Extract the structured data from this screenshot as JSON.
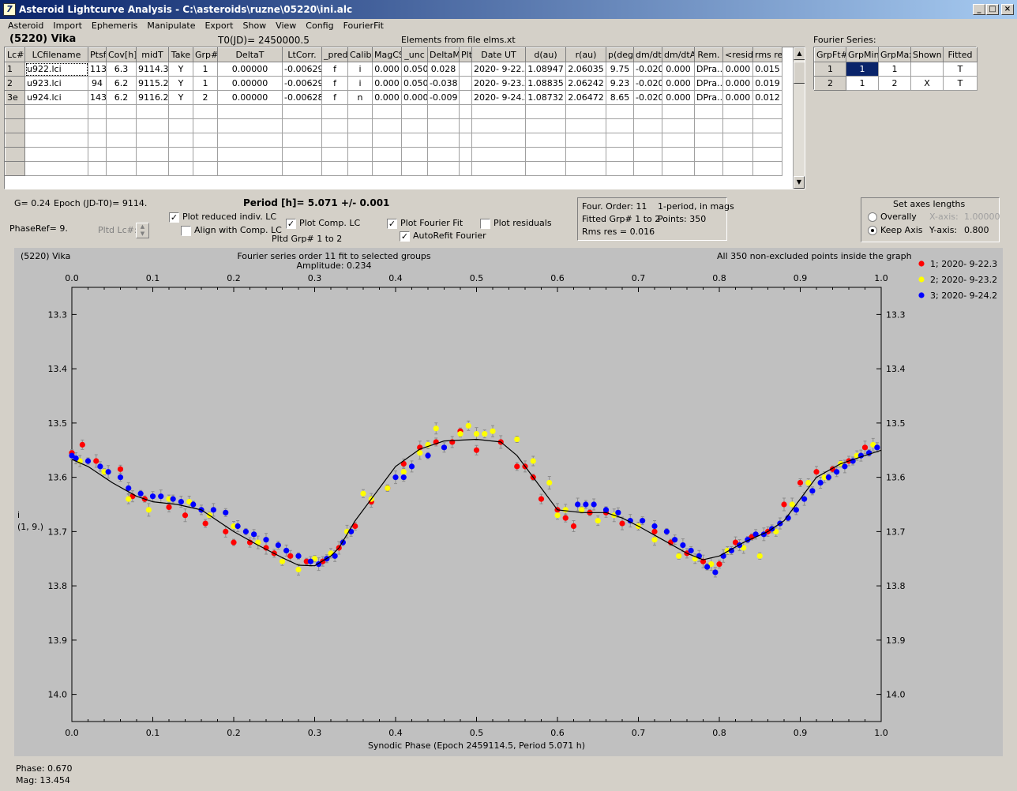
{
  "window": {
    "title": "Asteroid Lightcurve Analysis - C:\\asteroids\\ruzne\\05220\\ini.alc",
    "icon": "app-logo-icon",
    "controls": [
      "_",
      "□",
      "×"
    ]
  },
  "menu": [
    "Asteroid",
    "Import",
    "Ephemeris",
    "Manipulate",
    "Export",
    "Show",
    "View",
    "Config",
    "FourierFit"
  ],
  "header": {
    "asteroid": "(5220) Vika",
    "t0": "T0(JD)= 2450000.5",
    "elements": "Elements from file elms.xt",
    "fourier_label": "Fourier Series:"
  },
  "lc_table": {
    "columns": [
      "Lc#",
      "LCfilename",
      "Ptsf",
      "Cov[h]",
      "midT",
      "Take",
      "Grp#",
      "DeltaT",
      "LtCorr.",
      "_pred.",
      "Calib",
      "MagCS",
      "_unc",
      "DeltaM",
      "Plt",
      "Date UT",
      "d(au)",
      "r(au)",
      "p(deg)",
      "dm/dt",
      "dm/dtA",
      "Rem.",
      "<resid>",
      "rms res"
    ],
    "rows": [
      [
        "1",
        "u922.lci",
        "113",
        "6.3",
        "9114.3",
        "Y",
        "1",
        "0.00000",
        "-0.00629",
        "f",
        "i",
        "0.000",
        "0.050",
        "0.028",
        "",
        "2020- 9-22.3",
        "1.08947",
        "2.06035",
        "9.75",
        "-0.020",
        "0.000",
        "DPra...",
        "0.000",
        "0.015"
      ],
      [
        "2",
        "u923.lci",
        "94",
        "6.2",
        "9115.2",
        "Y",
        "1",
        "0.00000",
        "-0.00629",
        "f",
        "i",
        "0.000",
        "0.050",
        "-0.038",
        "",
        "2020- 9-23.2",
        "1.08835",
        "2.06242",
        "9.23",
        "-0.020",
        "0.000",
        "DPra...",
        "0.000",
        "0.019"
      ],
      [
        "3e",
        "u924.lci",
        "143",
        "6.2",
        "9116.2",
        "Y",
        "2",
        "0.00000",
        "-0.00628",
        "f",
        "n",
        "0.000",
        "0.000",
        "-0.009",
        "",
        "2020- 9-24.2",
        "1.08732",
        "2.06472",
        "8.65",
        "-0.020",
        "0.000",
        "DPra...",
        "0.000",
        "0.012"
      ]
    ]
  },
  "fourier_table": {
    "columns": [
      "GrpFt#",
      "GrpMin",
      "GrpMax",
      "Shown",
      "Fitted"
    ],
    "rows": [
      [
        "1",
        "1",
        "1",
        "",
        "T"
      ],
      [
        "2",
        "1",
        "2",
        "X",
        "T"
      ]
    ]
  },
  "params": {
    "g": "G= 0.24",
    "epoch": "Epoch (JD-T0)= 9114.",
    "period": "Period [h]= 5.071 +/- 0.001",
    "phaseref": "PhaseRef= 9.",
    "pltd_lc": "Pltd Lc#:",
    "pltd_grp": "Pltd Grp#  1   to   2"
  },
  "checkboxes": [
    {
      "label": "Plot reduced indiv. LC",
      "checked": true
    },
    {
      "label": "Align with Comp. LC",
      "checked": false
    },
    {
      "label": "Plot Comp. LC",
      "checked": true
    },
    {
      "label": "Plot Fourier Fit",
      "checked": true
    },
    {
      "label": "AutoRefit Fourier",
      "checked": true
    },
    {
      "label": "Plot residuals",
      "checked": false
    }
  ],
  "fit_info": {
    "order": "Four. Order: 11",
    "mode": "1-period, in mags",
    "grp": "Fitted Grp# 1 to 2",
    "points": "Points: 350",
    "rms": "Rms res     = 0.016"
  },
  "axes_box": {
    "title": "Set axes lengths",
    "overally": "Overally",
    "keep": "Keep Axis",
    "xlabel": "X-axis:",
    "xval": "1.00000",
    "ylabel": "Y-axis:",
    "yval": "0.800",
    "selected": "Keep Axis"
  },
  "status": {
    "phase": "Phase:  0.670",
    "mag": "Mag:    13.454"
  },
  "chart_data": {
    "type": "scatter",
    "title": "(5220) Vika",
    "subtitle": "Fourier series order 11 fit to selected groups",
    "amplitude": "Amplitude: 0.234",
    "note": "All 350 non-excluded points inside the graph",
    "xlabel": "Synodic Phase (Epoch 2459114.5, Period 5.071 h)",
    "ylabel": "i",
    "ylabel2": "(1, 9.)",
    "xlim": [
      0,
      1
    ],
    "ylim": [
      13.25,
      14.05
    ],
    "y_inverted": true,
    "xticks": [
      "0.0",
      "0.1",
      "0.2",
      "0.3",
      "0.4",
      "0.5",
      "0.6",
      "0.7",
      "0.8",
      "0.9",
      "1.0"
    ],
    "yticks": [
      "13.3",
      "13.4",
      "13.5",
      "13.6",
      "13.7",
      "13.8",
      "13.9",
      "14.0"
    ],
    "legend_position": "top-right",
    "fit_curve": {
      "x": [
        0,
        0.02,
        0.05,
        0.08,
        0.1,
        0.13,
        0.16,
        0.2,
        0.23,
        0.26,
        0.28,
        0.3,
        0.32,
        0.33,
        0.35,
        0.38,
        0.4,
        0.43,
        0.46,
        0.5,
        0.53,
        0.55,
        0.57,
        0.6,
        0.63,
        0.66,
        0.68,
        0.7,
        0.73,
        0.76,
        0.78,
        0.8,
        0.83,
        0.86,
        0.88,
        0.9,
        0.92,
        0.95,
        0.98,
        1.0
      ],
      "y": [
        13.567,
        13.58,
        13.61,
        13.635,
        13.645,
        13.65,
        13.66,
        13.7,
        13.725,
        13.748,
        13.762,
        13.763,
        13.745,
        13.73,
        13.68,
        13.62,
        13.58,
        13.548,
        13.533,
        13.53,
        13.535,
        13.56,
        13.6,
        13.66,
        13.665,
        13.665,
        13.675,
        13.69,
        13.715,
        13.74,
        13.752,
        13.745,
        13.72,
        13.7,
        13.68,
        13.64,
        13.6,
        13.575,
        13.56,
        13.55
      ]
    },
    "series": [
      {
        "name": "1; 2020- 9-22.3",
        "color": "#ff0000",
        "x": [
          0.0,
          0.013,
          0.03,
          0.06,
          0.075,
          0.09,
          0.12,
          0.14,
          0.165,
          0.19,
          0.2,
          0.22,
          0.24,
          0.25,
          0.27,
          0.29,
          0.31,
          0.33,
          0.35,
          0.37,
          0.39,
          0.41,
          0.43,
          0.45,
          0.47,
          0.48,
          0.5,
          0.53,
          0.55,
          0.56,
          0.57,
          0.58,
          0.6,
          0.61,
          0.62,
          0.64,
          0.66,
          0.68,
          0.7,
          0.72,
          0.74,
          0.76,
          0.78,
          0.8,
          0.82,
          0.84,
          0.86,
          0.88,
          0.9,
          0.92,
          0.94,
          0.96,
          0.98
        ],
        "y": [
          13.555,
          13.54,
          13.57,
          13.585,
          13.635,
          13.64,
          13.655,
          13.67,
          13.685,
          13.7,
          13.72,
          13.72,
          13.73,
          13.74,
          13.745,
          13.755,
          13.755,
          13.73,
          13.69,
          13.645,
          13.62,
          13.575,
          13.545,
          13.535,
          13.535,
          13.515,
          13.55,
          13.535,
          13.58,
          13.58,
          13.6,
          13.64,
          13.66,
          13.675,
          13.69,
          13.665,
          13.665,
          13.685,
          13.69,
          13.7,
          13.72,
          13.74,
          13.755,
          13.76,
          13.72,
          13.71,
          13.7,
          13.65,
          13.61,
          13.59,
          13.585,
          13.57,
          13.545
        ]
      },
      {
        "name": "2; 2020- 9-23.2",
        "color": "#ffff00",
        "x": [
          0.01,
          0.04,
          0.07,
          0.095,
          0.12,
          0.145,
          0.17,
          0.2,
          0.23,
          0.26,
          0.28,
          0.3,
          0.32,
          0.34,
          0.36,
          0.37,
          0.39,
          0.41,
          0.43,
          0.44,
          0.45,
          0.48,
          0.49,
          0.5,
          0.51,
          0.52,
          0.55,
          0.57,
          0.59,
          0.6,
          0.61,
          0.63,
          0.65,
          0.67,
          0.7,
          0.72,
          0.75,
          0.77,
          0.79,
          0.81,
          0.83,
          0.85,
          0.87,
          0.89,
          0.91,
          0.93,
          0.95,
          0.97,
          0.99
        ],
        "y": [
          13.57,
          13.59,
          13.64,
          13.66,
          13.64,
          13.645,
          13.67,
          13.69,
          13.72,
          13.755,
          13.77,
          13.75,
          13.74,
          13.7,
          13.63,
          13.64,
          13.62,
          13.59,
          13.555,
          13.54,
          13.51,
          13.52,
          13.505,
          13.52,
          13.52,
          13.515,
          13.53,
          13.57,
          13.61,
          13.67,
          13.66,
          13.66,
          13.68,
          13.67,
          13.69,
          13.715,
          13.745,
          13.75,
          13.76,
          13.735,
          13.73,
          13.745,
          13.7,
          13.65,
          13.61,
          13.6,
          13.575,
          13.56,
          13.54
        ]
      },
      {
        "name": "3; 2020- 9-24.2",
        "color": "#0000ff",
        "x": [
          0.0,
          0.005,
          0.02,
          0.035,
          0.045,
          0.06,
          0.07,
          0.085,
          0.1,
          0.11,
          0.125,
          0.135,
          0.15,
          0.16,
          0.175,
          0.19,
          0.205,
          0.215,
          0.225,
          0.24,
          0.255,
          0.265,
          0.28,
          0.295,
          0.305,
          0.315,
          0.325,
          0.335,
          0.345,
          0.4,
          0.41,
          0.42,
          0.44,
          0.46,
          0.625,
          0.635,
          0.645,
          0.66,
          0.675,
          0.69,
          0.705,
          0.72,
          0.735,
          0.745,
          0.755,
          0.765,
          0.775,
          0.785,
          0.795,
          0.805,
          0.815,
          0.825,
          0.835,
          0.845,
          0.855,
          0.865,
          0.875,
          0.885,
          0.895,
          0.905,
          0.915,
          0.925,
          0.935,
          0.945,
          0.955,
          0.965,
          0.975,
          0.985,
          0.995
        ],
        "y": [
          13.56,
          13.565,
          13.57,
          13.58,
          13.59,
          13.6,
          13.62,
          13.63,
          13.635,
          13.635,
          13.64,
          13.645,
          13.65,
          13.66,
          13.66,
          13.665,
          13.69,
          13.7,
          13.705,
          13.715,
          13.725,
          13.735,
          13.745,
          13.755,
          13.76,
          13.75,
          13.745,
          13.72,
          13.7,
          13.6,
          13.6,
          13.58,
          13.56,
          13.545,
          13.65,
          13.65,
          13.65,
          13.66,
          13.665,
          13.68,
          13.68,
          13.69,
          13.7,
          13.715,
          13.725,
          13.735,
          13.745,
          13.765,
          13.775,
          13.745,
          13.735,
          13.725,
          13.715,
          13.705,
          13.705,
          13.695,
          13.685,
          13.675,
          13.66,
          13.64,
          13.625,
          13.61,
          13.6,
          13.59,
          13.58,
          13.57,
          13.56,
          13.555,
          13.545
        ]
      }
    ]
  }
}
